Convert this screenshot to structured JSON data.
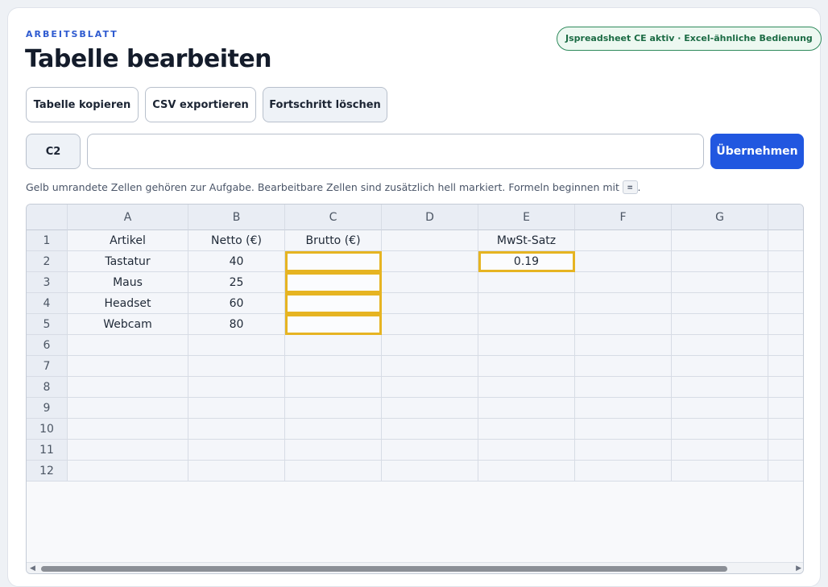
{
  "header": {
    "eyebrow": "ARBEITSBLATT",
    "title": "Tabelle bearbeiten",
    "badge": "Jspreadsheet CE aktiv · Excel-ähnliche Bedienung"
  },
  "toolbar": {
    "copy_label": "Tabelle kopieren",
    "csv_label": "CSV exportieren",
    "clear_label": "Fortschritt löschen"
  },
  "formula_bar": {
    "cell_ref": "C2",
    "value": "",
    "apply_label": "Übernehmen"
  },
  "hint": {
    "text": "Gelb umrandete Zellen gehören zur Aufgabe. Bearbeitbare Zellen sind zusätzlich hell markiert. Formeln beginnen mit",
    "kbd": "=",
    "end": "."
  },
  "sheet": {
    "columns": [
      "A",
      "B",
      "C",
      "D",
      "E",
      "F",
      "G"
    ],
    "rows": [
      {
        "n": "1",
        "cells": [
          "Artikel",
          "Netto (€)",
          "Brutto (€)",
          "",
          "MwSt-Satz",
          "",
          ""
        ]
      },
      {
        "n": "2",
        "cells": [
          "Tastatur",
          "40",
          "",
          "",
          "0.19",
          "",
          ""
        ]
      },
      {
        "n": "3",
        "cells": [
          "Maus",
          "25",
          "",
          "",
          "",
          "",
          ""
        ]
      },
      {
        "n": "4",
        "cells": [
          "Headset",
          "60",
          "",
          "",
          "",
          "",
          ""
        ]
      },
      {
        "n": "5",
        "cells": [
          "Webcam",
          "80",
          "",
          "",
          "",
          "",
          ""
        ]
      },
      {
        "n": "6",
        "cells": [
          "",
          "",
          "",
          "",
          "",
          "",
          ""
        ]
      },
      {
        "n": "7",
        "cells": [
          "",
          "",
          "",
          "",
          "",
          "",
          ""
        ]
      },
      {
        "n": "8",
        "cells": [
          "",
          "",
          "",
          "",
          "",
          "",
          ""
        ]
      },
      {
        "n": "9",
        "cells": [
          "",
          "",
          "",
          "",
          "",
          "",
          ""
        ]
      },
      {
        "n": "10",
        "cells": [
          "",
          "",
          "",
          "",
          "",
          "",
          ""
        ]
      },
      {
        "n": "11",
        "cells": [
          "",
          "",
          "",
          "",
          "",
          "",
          ""
        ]
      },
      {
        "n": "12",
        "cells": [
          "",
          "",
          "",
          "",
          "",
          "",
          ""
        ]
      }
    ],
    "task_cells": [
      "C2",
      "C3",
      "C4",
      "C5",
      "E2"
    ],
    "selected_cell": "C2"
  },
  "colors": {
    "accent": "#2157e0",
    "task_border": "#e6b422",
    "badge_green": "#1b6b44"
  }
}
